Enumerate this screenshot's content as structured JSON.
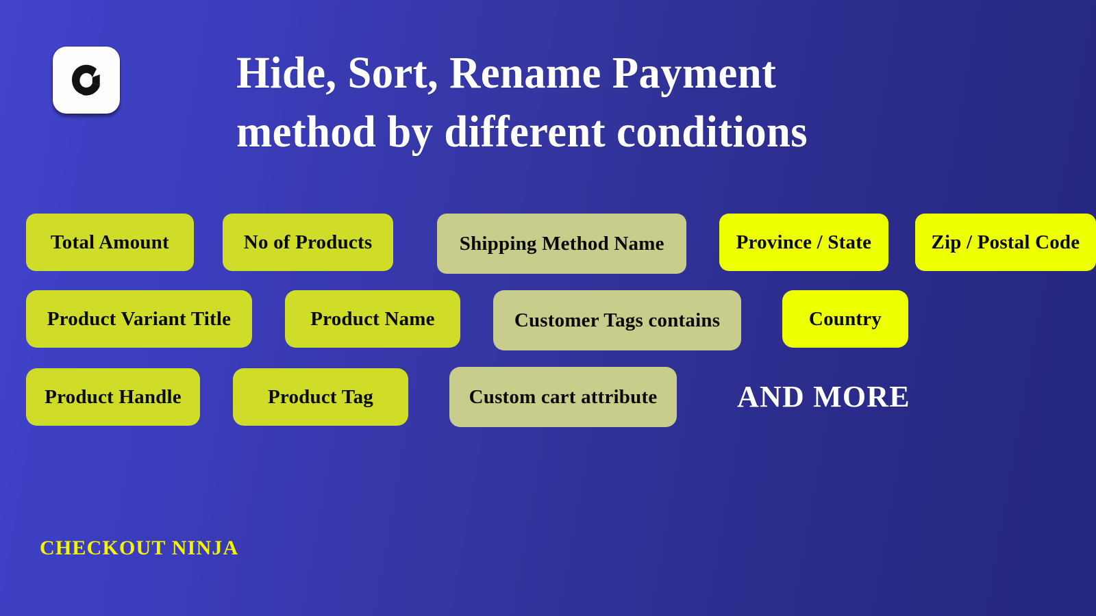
{
  "brand": {
    "logo_icon": "checkout-ninja-c-logo-icon",
    "logo_letter": "C",
    "footer_label": "CHECKOUT NINJA",
    "footer_color": "#f5f500"
  },
  "header": {
    "title_line_1": "Hide, Sort, Rename Payment",
    "title_line_2": "method by different conditions",
    "title_color": "#ffffff"
  },
  "theme": {
    "background_from": "#4244cb",
    "background_to": "#262780",
    "pill_standard": "#cfdc28",
    "pill_muted": "#c8cd8c",
    "pill_bright": "#eeff00",
    "pill_text": "#0b0b06"
  },
  "conditions": {
    "rows": [
      {
        "pills": [
          {
            "label": "Total Amount",
            "tone": "standard"
          },
          {
            "label": "No of Products",
            "tone": "standard"
          },
          {
            "label": "Shipping Method Name",
            "tone": "muted"
          },
          {
            "label": "Province / State",
            "tone": "bright"
          },
          {
            "label": "Zip / Postal Code",
            "tone": "bright"
          }
        ]
      },
      {
        "pills": [
          {
            "label": "Product Variant Title",
            "tone": "standard"
          },
          {
            "label": "Product Name",
            "tone": "standard"
          },
          {
            "label": "Customer Tags contains",
            "tone": "muted"
          },
          {
            "label": "Country",
            "tone": "bright"
          }
        ]
      },
      {
        "pills": [
          {
            "label": "Product Handle",
            "tone": "standard"
          },
          {
            "label": "Product Tag",
            "tone": "standard"
          },
          {
            "label": "Custom cart attribute",
            "tone": "muted"
          }
        ],
        "trailing_text": "AND MORE"
      }
    ]
  }
}
